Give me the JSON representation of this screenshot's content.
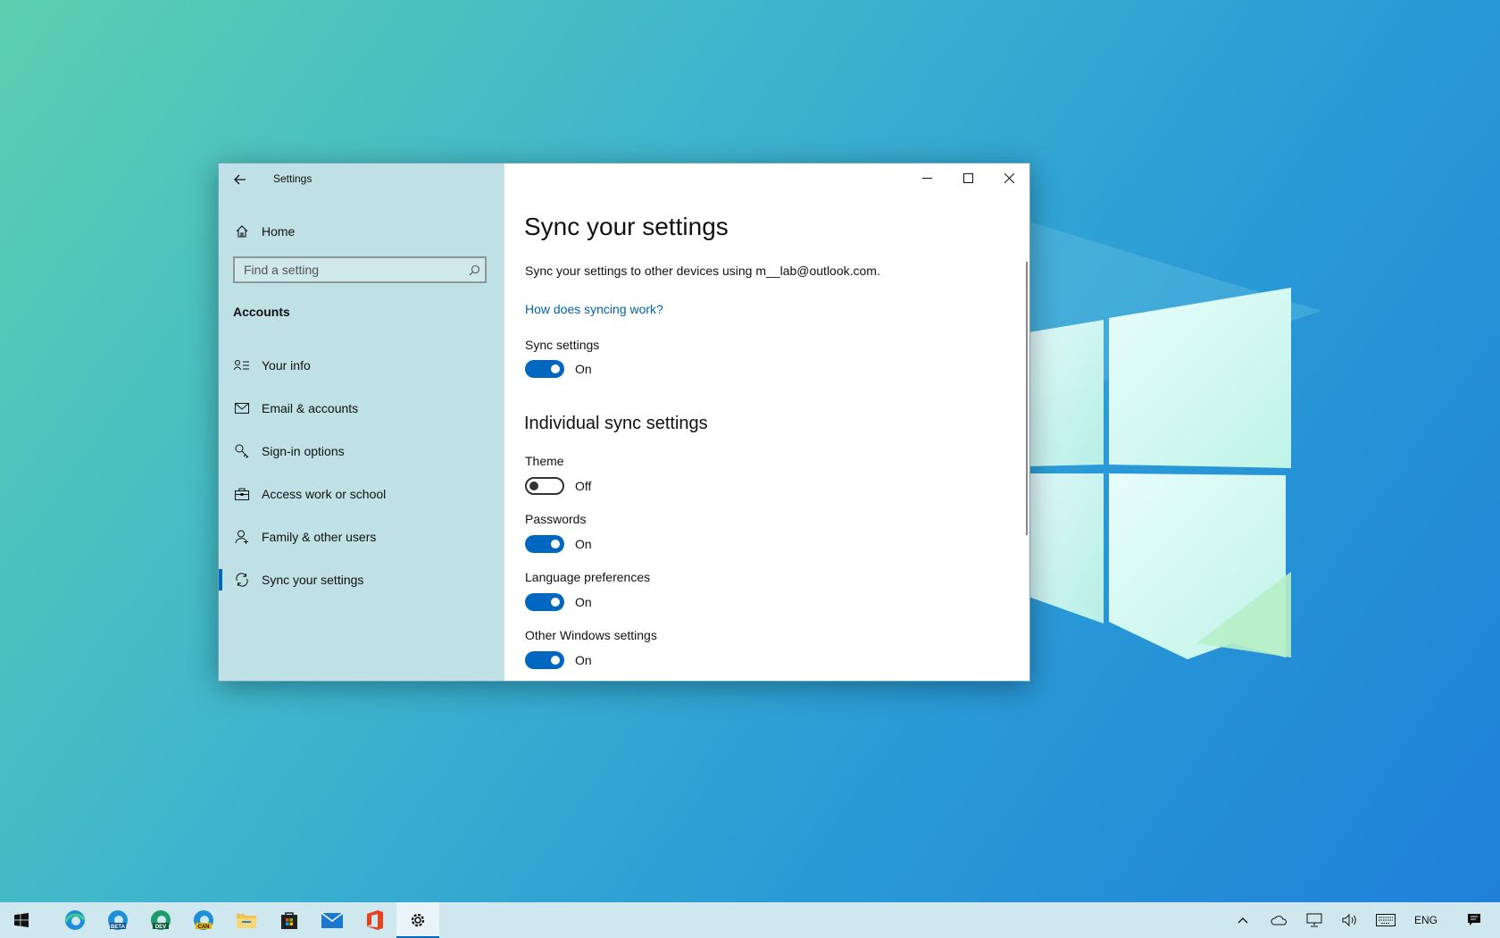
{
  "window": {
    "app_title": "Settings"
  },
  "sidebar": {
    "home_label": "Home",
    "search_placeholder": "Find a setting",
    "section": "Accounts",
    "items": [
      {
        "label": "Your info",
        "icon": "contact-card-icon"
      },
      {
        "label": "Email & accounts",
        "icon": "mail-icon"
      },
      {
        "label": "Sign-in options",
        "icon": "key-icon"
      },
      {
        "label": "Access work or school",
        "icon": "briefcase-icon"
      },
      {
        "label": "Family & other users",
        "icon": "person-add-icon"
      },
      {
        "label": "Sync your settings",
        "icon": "sync-icon",
        "active": true
      }
    ]
  },
  "main": {
    "title": "Sync your settings",
    "description": "Sync your settings to other devices using m__lab@outlook.com.",
    "help_link": "How does syncing work?",
    "sync_settings": {
      "label": "Sync settings",
      "state": "On"
    },
    "individual_heading": "Individual sync settings",
    "individual": [
      {
        "label": "Theme",
        "state": "Off"
      },
      {
        "label": "Passwords",
        "state": "On"
      },
      {
        "label": "Language preferences",
        "state": "On"
      },
      {
        "label": "Other Windows settings",
        "state": "On"
      }
    ]
  },
  "taskbar": {
    "apps": [
      {
        "name": "edge-icon",
        "badge": ""
      },
      {
        "name": "edge-beta-icon",
        "badge": "BETA"
      },
      {
        "name": "edge-dev-icon",
        "badge": "DEV"
      },
      {
        "name": "edge-canary-icon",
        "badge": "CAN"
      },
      {
        "name": "file-explorer-icon",
        "badge": ""
      },
      {
        "name": "store-icon",
        "badge": ""
      },
      {
        "name": "mail-icon",
        "badge": ""
      },
      {
        "name": "office-icon",
        "badge": ""
      },
      {
        "name": "settings-icon",
        "badge": ""
      }
    ],
    "language": "ENG"
  },
  "colors": {
    "accent": "#0067c0",
    "link": "#0063b1",
    "sidebar_bg": "#bfe1e6",
    "taskbar_bg": "#cfe7ee"
  }
}
